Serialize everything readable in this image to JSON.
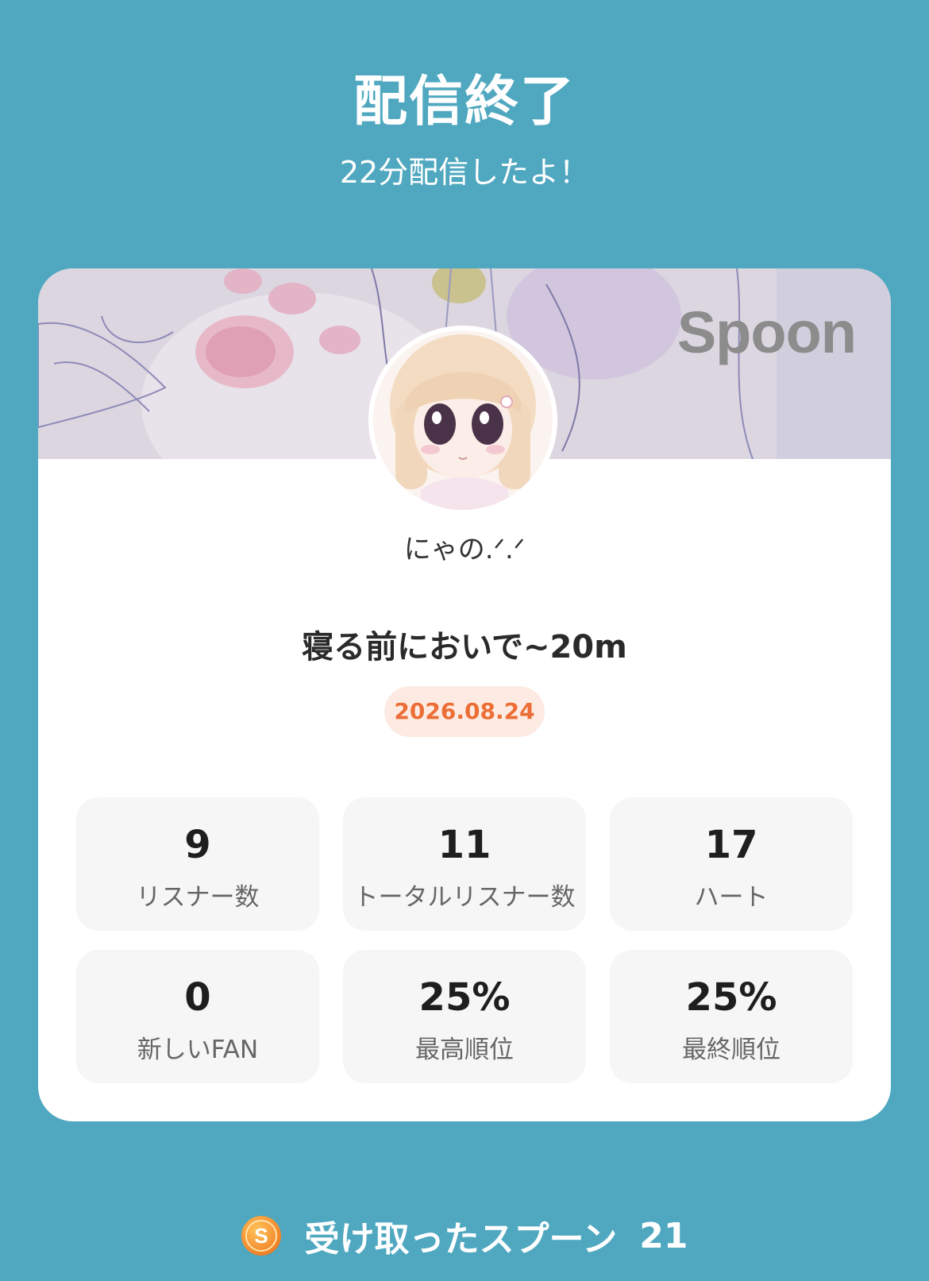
{
  "header": {
    "title": "配信終了",
    "subtitle": "22分配信したよ！"
  },
  "card": {
    "banner_logo": "Spoon",
    "username": "にゃの.ᐟ.ᐟ",
    "stream_title": "寝る前においで~20m",
    "date": "2026.08.24",
    "stats": [
      {
        "value": "9",
        "label": "リスナー数"
      },
      {
        "value": "11",
        "label": "トータルリスナー数"
      },
      {
        "value": "17",
        "label": "ハート"
      },
      {
        "value": "0",
        "label": "新しいFAN"
      },
      {
        "value": "25%",
        "label": "最高順位"
      },
      {
        "value": "25%",
        "label": "最終順位"
      }
    ]
  },
  "footer": {
    "coin_icon": "spoon-coin-icon",
    "coin_letter": "S",
    "label": "受け取ったスプーン",
    "count": "21"
  },
  "colors": {
    "background": "#4fa8c0",
    "card": "#ffffff",
    "stat_tile": "#f6f6f6",
    "date_badge_bg": "#fdebe3",
    "date_badge_text": "#ec6e36",
    "coin": "#f0862a"
  }
}
